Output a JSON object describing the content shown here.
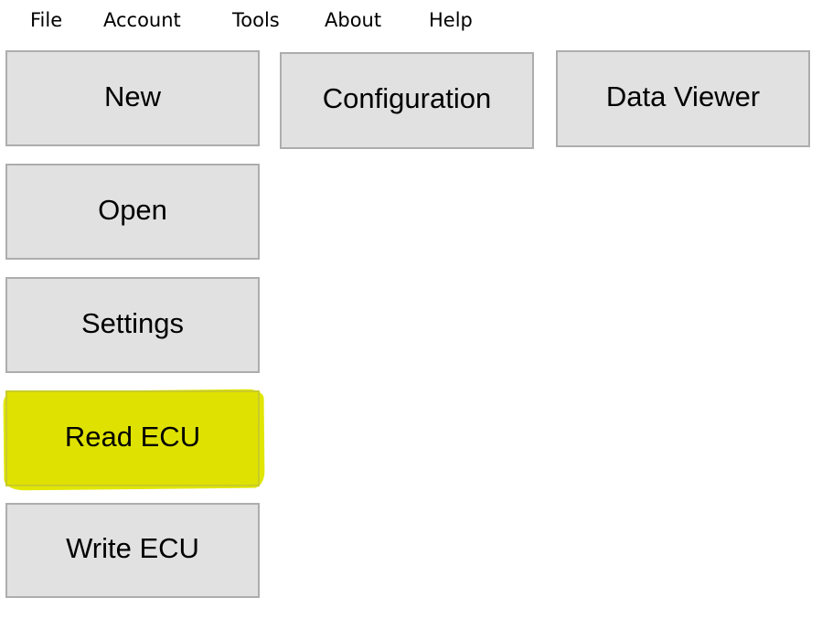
{
  "menubar": {
    "items": [
      {
        "label": "File"
      },
      {
        "label": "Account"
      },
      {
        "label": "Tools"
      },
      {
        "label": "About"
      },
      {
        "label": "Help"
      }
    ]
  },
  "main": {
    "buttons": {
      "new": "New",
      "configuration": "Configuration",
      "data_viewer": "Data Viewer",
      "open": "Open",
      "settings": "Settings",
      "read_ecu": "Read ECU",
      "write_ecu": "Write ECU"
    },
    "highlight_color": "#e0e600"
  }
}
